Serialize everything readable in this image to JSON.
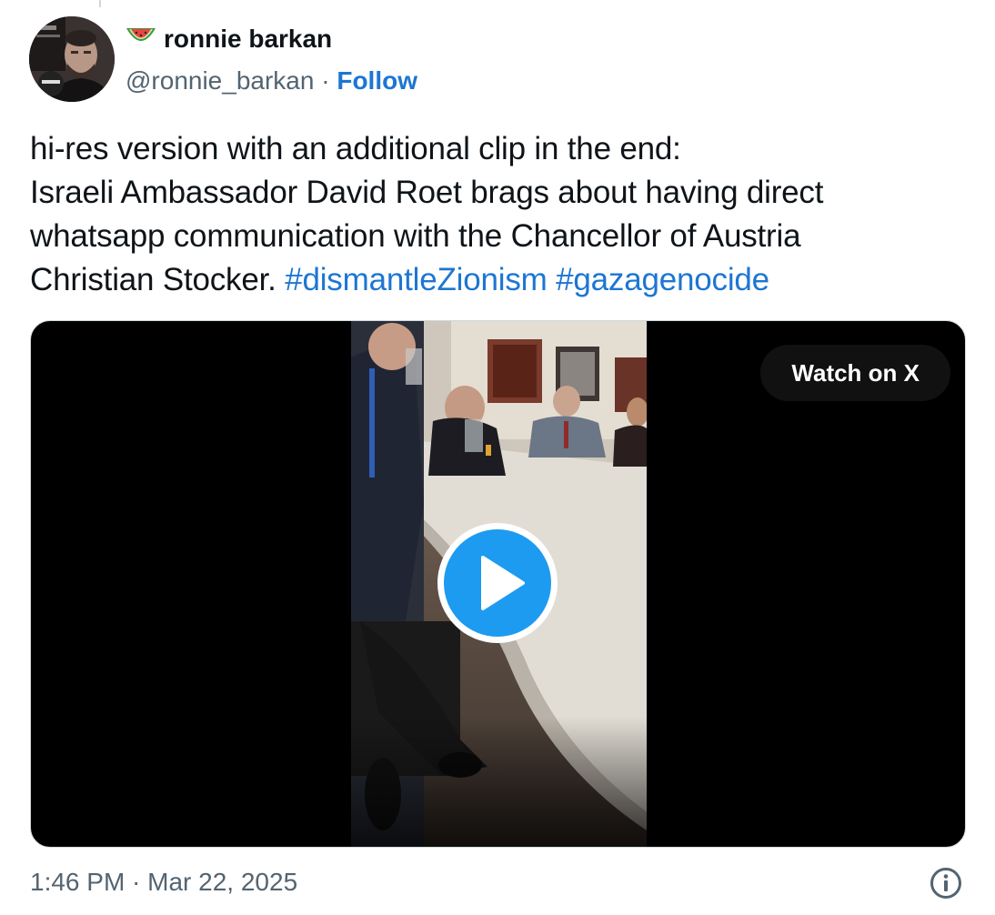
{
  "author": {
    "display_name": "ronnie barkan",
    "handle": "@ronnie_barkan",
    "separator": " · ",
    "follow_label": "Follow",
    "name_emoji": "watermelon-icon"
  },
  "tweet": {
    "lines": [
      "hi-res version with an additional clip in the end:",
      "Israeli Ambassador David Roet brags about having direct",
      "whatsapp communication with the Chancellor of Austria",
      "Christian Stocker. "
    ],
    "hashtags": [
      "#dismantleZionism",
      "#gazagenocide"
    ]
  },
  "media": {
    "watch_label": "Watch on X",
    "play_icon": "play-icon"
  },
  "footer": {
    "timestamp": "1:46 PM · Mar 22, 2025",
    "info_icon": "info-icon"
  },
  "colors": {
    "link": "#1d76d2",
    "play_button": "#1d9bf0",
    "secondary_text": "#536471"
  }
}
